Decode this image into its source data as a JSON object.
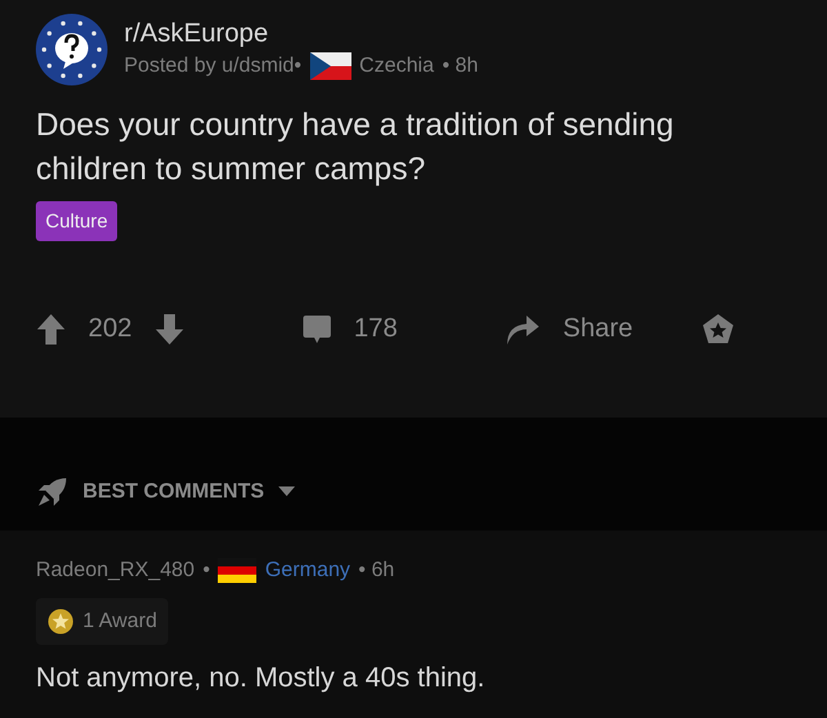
{
  "post": {
    "subreddit": "r/AskEurope",
    "posted_by": "Posted by u/dsmid•",
    "user_flair": "Czechia",
    "time": "• 8h",
    "title": "Does your country have a tradition of sending children to summer camps?",
    "flair": "Culture"
  },
  "actions": {
    "score": "202",
    "comments": "178",
    "share": "Share"
  },
  "sort": {
    "label": "BEST COMMENTS"
  },
  "comment": {
    "author": "Radeon_RX_480",
    "separator": "•",
    "user_flair": "Germany",
    "time": "• 6h",
    "award": "1 Award",
    "body": "Not anymore, no. Mostly a 40s thing."
  }
}
